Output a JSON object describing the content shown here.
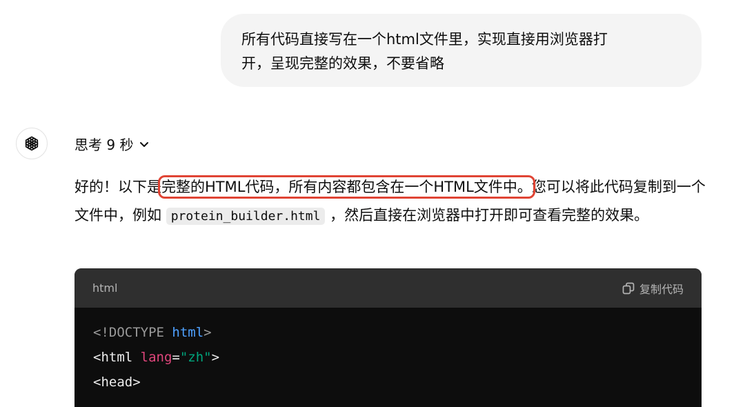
{
  "user_message": {
    "line1": "所有代码直接写在一个html文件里，实现直接用浏览器打",
    "line2": "开，呈现完整的效果，不要省略"
  },
  "assistant": {
    "avatar_icon": "openai-logo-icon",
    "thinking_label": "思考 9 秒",
    "response": {
      "part1": "好的！以下是",
      "highlight": "完整的HTML代码，所有内容都包含在一个HTML文件中。",
      "part2": "您可以将此代码复制到一个文件中，例如 ",
      "filename": "protein_builder.html",
      "part3": " ，然后直接在浏览器中打开即可查看完整的效果。"
    },
    "code_block": {
      "language": "html",
      "copy_label": "复制代码",
      "lines": {
        "l1_open": "<!DOCTYPE ",
        "l1_kw": "html",
        "l1_close": ">",
        "l2_open": "<html ",
        "l2_attr": "lang",
        "l2_eq": "=",
        "l2_str": "\"zh\"",
        "l2_close": ">",
        "l3": "<head>"
      }
    }
  },
  "colors": {
    "highlight_border": "#e04434",
    "bubble_bg": "#f4f4f4",
    "code_bg": "#0d0d0d",
    "code_header_bg": "#2f2f2f"
  }
}
